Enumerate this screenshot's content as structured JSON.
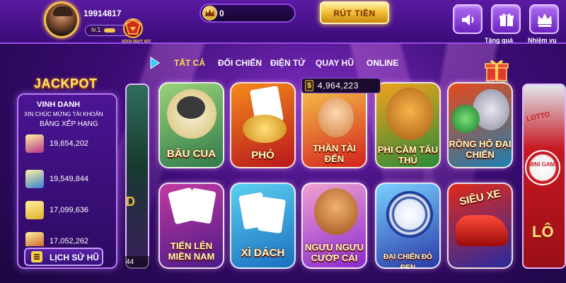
{
  "user": {
    "id": "19914817",
    "level": "lv.1",
    "level_progress": 0.35
  },
  "event_badge_text": "XÔCH XĐƯT XỦT",
  "balance": {
    "amount": "0"
  },
  "withdraw_label": "RÚT TIỀN",
  "top_icons": {
    "sound": {
      "icon": "speaker-icon"
    },
    "gift": {
      "icon": "gift-icon",
      "label": "Tặng quà"
    },
    "mission": {
      "icon": "crown-icon",
      "label": "Nhiệm vụ"
    }
  },
  "tabs": [
    {
      "label": "TẤT CẢ",
      "active": true
    },
    {
      "label": "ĐỐI CHIẾN",
      "active": false
    },
    {
      "label": "ĐIỆN TỬ",
      "active": false
    },
    {
      "label": "QUAY HŨ",
      "active": false
    },
    {
      "label": "ONLINE",
      "active": false
    }
  ],
  "jackpot": {
    "title": "JACKPOT",
    "subtitle": "VINH DANH",
    "line1": "XIN CHÚC MỪNG TÀI KHOẢN",
    "line2": "BẢNG XẾP HẠNG",
    "rows": [
      {
        "value": "19,654,202",
        "color": "#b5338a"
      },
      {
        "value": "19,549,844",
        "color": "#3a7fd4"
      },
      {
        "value": "17,099,636",
        "color": "#e0b02a"
      },
      {
        "value": "17,052,262",
        "color": "#c24a1a"
      }
    ],
    "history_label": "LỊCH SỬ HŨ"
  },
  "pot_value": "4,964,223",
  "gift_tag": "QUÀ TẶNG",
  "games_row1": [
    {
      "name": "BẦU CUA",
      "colors": [
        "#2f7a4a",
        "#9bd27a"
      ]
    },
    {
      "name": "PHỎ",
      "colors": [
        "#b8161c",
        "#f38a1c"
      ]
    },
    {
      "name": "THẦN TÀI ĐẾN",
      "colors": [
        "#d4201e",
        "#f6c84a"
      ]
    },
    {
      "name": "PHI CẦM TẨU THÚ",
      "colors": [
        "#2a8a3a",
        "#f0a21c"
      ]
    },
    {
      "name": "RỒNG HỔ ĐẠI CHIẾN",
      "colors": [
        "#1c7fb0",
        "#e64a1a"
      ]
    }
  ],
  "games_row2": [
    {
      "name": "TIẾN LÊN MIỀN NAM",
      "colors": [
        "#4a1a8a",
        "#c23aa0"
      ]
    },
    {
      "name": "XÌ DÁCH",
      "colors": [
        "#1a6fc0",
        "#5bd0f0"
      ]
    },
    {
      "name": "NGƯU NGƯU CƯỚP CÁI",
      "colors": [
        "#8a2ad0",
        "#f0a0d0"
      ]
    },
    {
      "name": "ĐẠI CHIẾN ĐỎ ĐEN",
      "colors": [
        "#2a3aa8",
        "#7ad0ff"
      ]
    },
    {
      "name": "SIÊU XE",
      "colors": [
        "#2a2aa0",
        "#e02a1a"
      ]
    }
  ],
  "side_right": {
    "lotto": "LOTTO",
    "minigame": "MINI GAME",
    "lo": "LÔ"
  },
  "side_left": {
    "text": "D",
    "value": "44"
  }
}
